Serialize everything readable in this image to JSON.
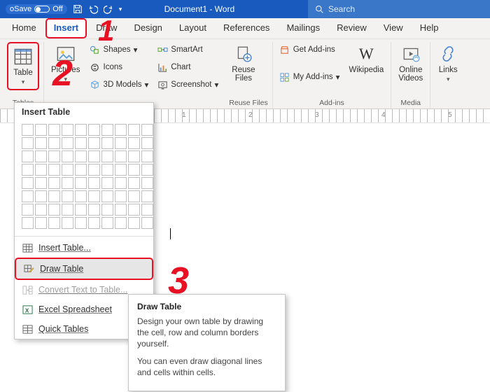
{
  "titlebar": {
    "autosave_label": "oSave",
    "autosave_state": "Off",
    "doc_title": "Document1 - Word",
    "search_placeholder": "Search"
  },
  "tabs": [
    "Home",
    "Insert",
    "Draw",
    "Design",
    "Layout",
    "References",
    "Mailings",
    "Review",
    "View",
    "Help"
  ],
  "active_tab": "Insert",
  "ribbon": {
    "tables": {
      "btn": "Table",
      "label": "Tables"
    },
    "illus": {
      "pictures": "Pictures",
      "shapes": "Shapes",
      "icons": "Icons",
      "models": "3D Models"
    },
    "illus2": {
      "smartart": "SmartArt",
      "chart": "Chart",
      "screenshot": "Screenshot"
    },
    "reuse": {
      "btn": "Reuse\nFiles",
      "label": "Reuse Files"
    },
    "addins": {
      "get": "Get Add-ins",
      "my": "My Add-ins",
      "wiki": "Wikipedia",
      "label": "Add-ins"
    },
    "media": {
      "btn": "Online\nVideos",
      "label": "Media"
    },
    "links": {
      "btn": "Links"
    }
  },
  "table_menu": {
    "header": "Insert Table",
    "items": [
      "Insert Table...",
      "Draw Table",
      "Convert Text to Table...",
      "Excel Spreadsheet",
      "Quick Tables"
    ]
  },
  "tooltip": {
    "title": "Draw Table",
    "p1": "Design your own table by drawing the cell, row and column borders yourself.",
    "p2": "You can even draw diagonal lines and cells within cells."
  },
  "annotations": {
    "one": "1",
    "two": "2",
    "three": "3"
  },
  "ruler_marks": [
    "1",
    "2",
    "3",
    "4",
    "5"
  ],
  "colors": {
    "accent": "#185ABD",
    "annotation": "#E81123"
  }
}
